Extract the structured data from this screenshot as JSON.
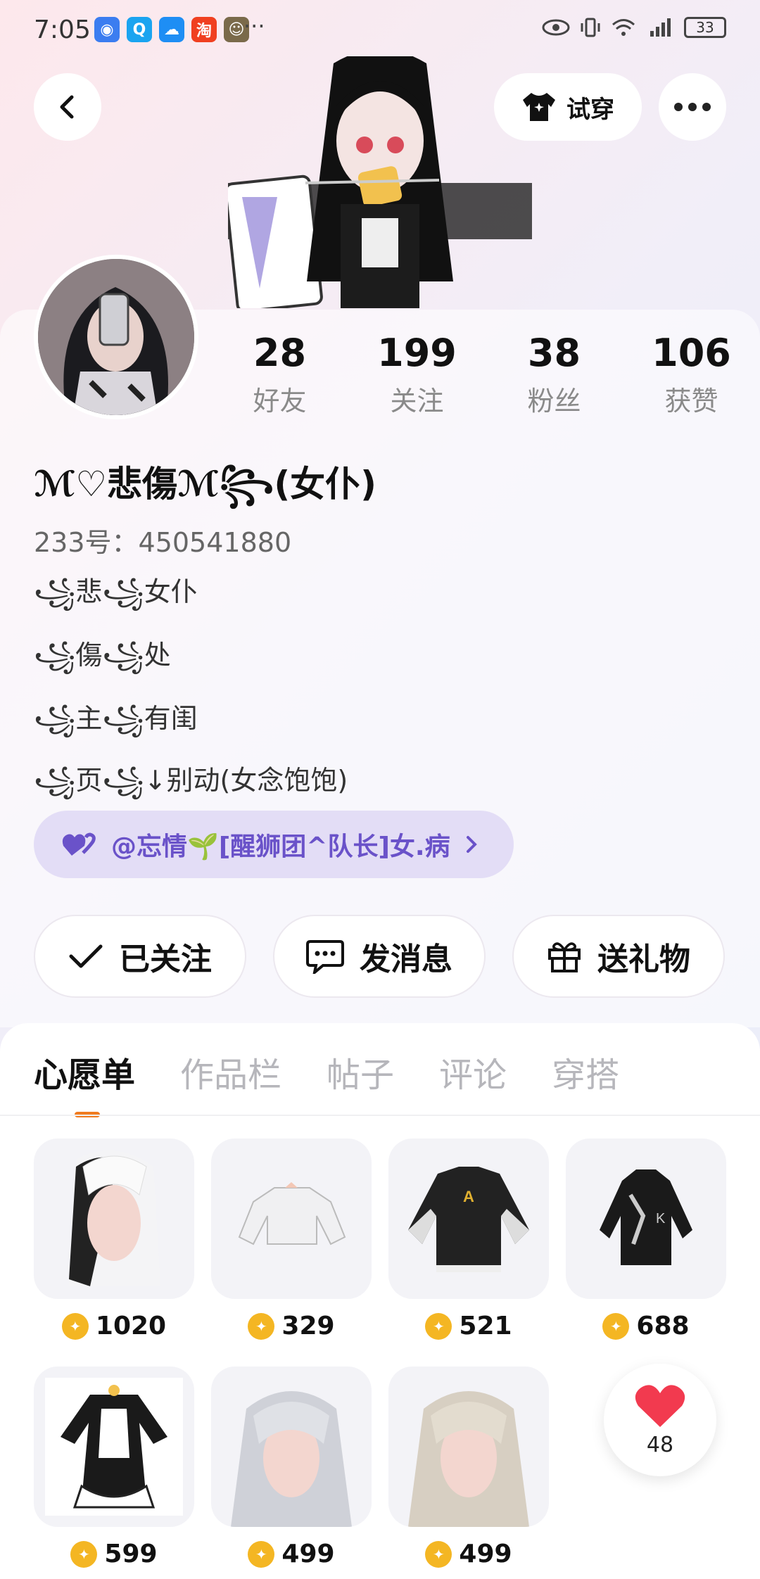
{
  "status_bar": {
    "time": "7:05",
    "more": "···",
    "battery": "33",
    "network": "4G"
  },
  "header": {
    "tryon_label": "试穿"
  },
  "stats": [
    {
      "value": "28",
      "label": "好友"
    },
    {
      "value": "199",
      "label": "关注"
    },
    {
      "value": "38",
      "label": "粉丝"
    },
    {
      "value": "106",
      "label": "获赞"
    }
  ],
  "profile": {
    "username": "ℳ♡悲傷ℳ꧂(女仆)",
    "user_id": "233号：450541880",
    "bio": [
      "꧁悲꧁女仆",
      "꧁傷꧁处",
      "꧁主꧁有闺",
      "꧁页꧁↓别动(女念饱饱)"
    ],
    "guild_tag": "@忘情🌱[醒狮团^队长]女.病"
  },
  "actions": {
    "follow": "已关注",
    "message": "发消息",
    "gift": "送礼物"
  },
  "tabs": [
    "心愿单",
    "作品栏",
    "帖子",
    "评论",
    "穿搭"
  ],
  "wishlist": [
    {
      "price": "1020",
      "item": "white-hair"
    },
    {
      "price": "329",
      "item": "white-crop-top"
    },
    {
      "price": "521",
      "item": "varsity-jacket"
    },
    {
      "price": "688",
      "item": "black-hoodie"
    },
    {
      "price": "599",
      "item": "maid-dress"
    },
    {
      "price": "499",
      "item": "silver-hair"
    },
    {
      "price": "499",
      "item": "blonde-hair"
    }
  ],
  "like_count": "48",
  "colors": {
    "accent": "#f07b1f",
    "guild_bg": "#e3ddf6",
    "guild_text": "#6a52c9",
    "coin": "#f4b623",
    "heart": "#f23a4f"
  }
}
